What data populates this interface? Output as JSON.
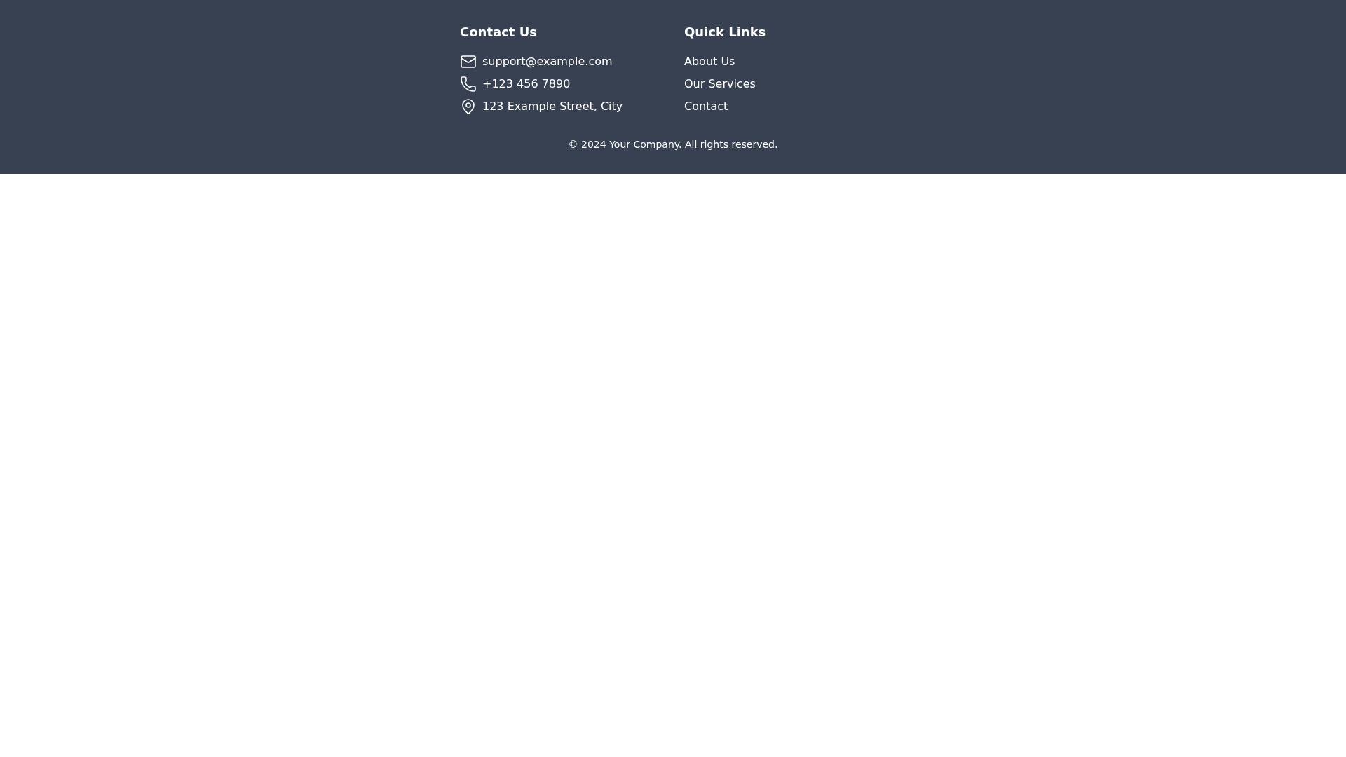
{
  "contact": {
    "heading": "Contact Us",
    "items": [
      {
        "kind": "email",
        "text": "support@example.com"
      },
      {
        "kind": "phone",
        "text": "+123 456 7890"
      },
      {
        "kind": "address",
        "text": "123 Example Street, City"
      }
    ]
  },
  "quick_links": {
    "heading": "Quick Links",
    "links": [
      "About Us",
      "Our Services",
      "Contact"
    ]
  },
  "copyright": "© 2024 Your Company. All rights reserved."
}
